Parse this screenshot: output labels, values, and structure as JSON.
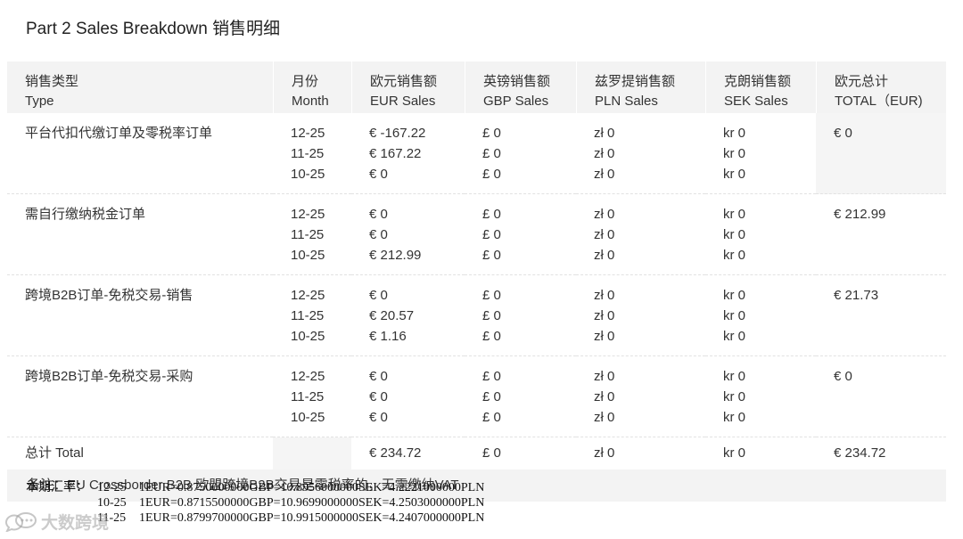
{
  "title": "Part 2 Sales Breakdown 销售明细",
  "headers": [
    {
      "cn": "销售类型",
      "en": "Type"
    },
    {
      "cn": "月份",
      "en": "Month"
    },
    {
      "cn": "欧元销售额",
      "en": "EUR Sales"
    },
    {
      "cn": "英镑销售额",
      "en": "GBP Sales"
    },
    {
      "cn": "兹罗提销售额",
      "en": "PLN Sales"
    },
    {
      "cn": "克朗销售额",
      "en": "SEK Sales"
    },
    {
      "cn": "欧元总计",
      "en": "TOTAL（EUR)"
    }
  ],
  "groups": [
    {
      "type": "平台代扣代缴订单及零税率订单",
      "months": [
        "12-25",
        "11-25",
        "10-25"
      ],
      "eur": [
        "€ -167.22",
        "€ 167.22",
        "€ 0"
      ],
      "gbp": [
        "£ 0",
        "£ 0",
        "£ 0"
      ],
      "pln": [
        "zł 0",
        "zł 0",
        "zł 0"
      ],
      "sek": [
        "kr 0",
        "kr 0",
        "kr 0"
      ],
      "total": "€ 0"
    },
    {
      "type": "需自行缴纳税金订单",
      "months": [
        "12-25",
        "11-25",
        "10-25"
      ],
      "eur": [
        "€ 0",
        "€ 0",
        "€ 212.99"
      ],
      "gbp": [
        "£ 0",
        "£ 0",
        "£ 0"
      ],
      "pln": [
        "zł 0",
        "zł 0",
        "zł 0"
      ],
      "sek": [
        "kr 0",
        "kr 0",
        "kr 0"
      ],
      "total": "€ 212.99"
    },
    {
      "type": "跨境B2B订单-免税交易-销售",
      "months": [
        "12-25",
        "11-25",
        "10-25"
      ],
      "eur": [
        "€ 0",
        "€ 20.57",
        "€ 1.16"
      ],
      "gbp": [
        "£ 0",
        "£ 0",
        "£ 0"
      ],
      "pln": [
        "zł 0",
        "zł 0",
        "zł 0"
      ],
      "sek": [
        "kr 0",
        "kr 0",
        "kr 0"
      ],
      "total": "€ 21.73"
    },
    {
      "type": "跨境B2B订单-免税交易-采购",
      "months": [
        "12-25",
        "11-25",
        "10-25"
      ],
      "eur": [
        "€ 0",
        "€ 0",
        "€ 0"
      ],
      "gbp": [
        "£ 0",
        "£ 0",
        "£ 0"
      ],
      "pln": [
        "zł 0",
        "zł 0",
        "zł 0"
      ],
      "sek": [
        "kr 0",
        "kr 0",
        "kr 0"
      ],
      "total": "€ 0"
    }
  ],
  "total_row": {
    "label": "总计 Total",
    "eur": "€ 234.72",
    "gbp": "£ 0",
    "pln": "zł 0",
    "sek": "kr 0",
    "total": "€ 234.72"
  },
  "note": "备注：EU Crossborder B2B 欧盟跨境B2B交易是零税率的，无需缴纳VAT",
  "rates": {
    "label": "本期汇率：",
    "rows": [
      {
        "month": "12-25",
        "rate": "1EUR=0.8750000000GBP=10.8956000000SEK=4.2221000000PLN"
      },
      {
        "month": "10-25",
        "rate": "1EUR=0.8715500000GBP=10.9699000000SEK=4.2503000000PLN"
      },
      {
        "month": "11-25",
        "rate": "1EUR=0.8799700000GBP=10.9915000000SEK=4.2407000000PLN"
      }
    ]
  },
  "watermark": "大数跨境"
}
